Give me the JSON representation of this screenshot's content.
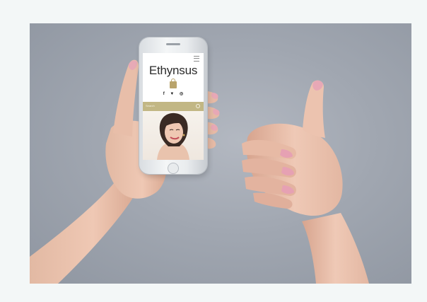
{
  "photo": {
    "background_color": "#a3a9b3",
    "subject": "hands holding smartphone and giving thumbs up"
  },
  "phone_screen": {
    "brand": "Ethynsus",
    "icons": {
      "menu": "hamburger-menu-icon",
      "bag": "shopping-bag-icon",
      "facebook": "facebook-icon",
      "twitter": "twitter-icon",
      "instagram": "instagram-icon",
      "search": "search-icon"
    },
    "social": {
      "facebook": "f",
      "twitter": "▼",
      "instagram": "◎"
    },
    "search_placeholder": "Search",
    "accent_color": "#c2b784"
  }
}
